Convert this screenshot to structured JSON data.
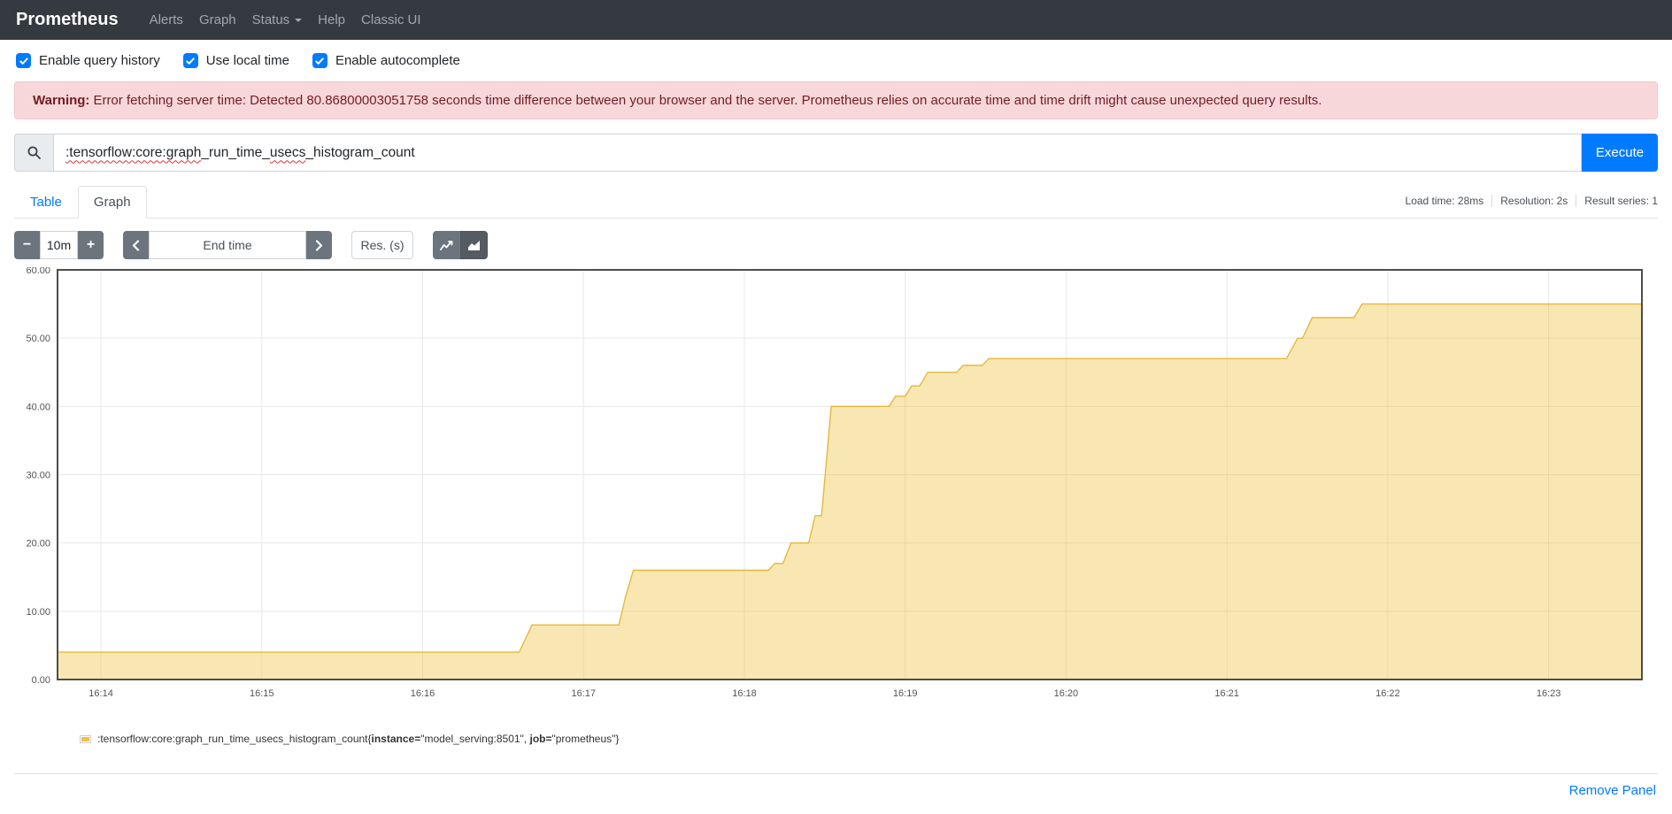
{
  "navbar": {
    "brand": "Prometheus",
    "items": [
      {
        "label": "Alerts",
        "caret": false
      },
      {
        "label": "Graph",
        "caret": false
      },
      {
        "label": "Status",
        "caret": true
      },
      {
        "label": "Help",
        "caret": false
      },
      {
        "label": "Classic UI",
        "caret": false
      }
    ]
  },
  "options": [
    {
      "label": "Enable query history",
      "checked": true
    },
    {
      "label": "Use local time",
      "checked": true
    },
    {
      "label": "Enable autocomplete",
      "checked": true
    }
  ],
  "warning": {
    "prefix": "Warning:",
    "message": "Error fetching server time: Detected 80.86800003051758 seconds time difference between your browser and the server. Prometheus relies on accurate time and time drift might cause unexpected query results."
  },
  "query": {
    "value": ":tensorflow:core:graph_run_time_usecs_histogram_count",
    "parts": [
      {
        "text": ":tensorflow:core:graph",
        "misspelled": true
      },
      {
        "text": "_run_time_",
        "misspelled": false
      },
      {
        "text": "usecs",
        "misspelled": true
      },
      {
        "text": "_histogram_count",
        "misspelled": false
      }
    ],
    "execute_label": "Execute",
    "search_icon": "magnifier"
  },
  "tabs": [
    {
      "label": "Table",
      "active": false
    },
    {
      "label": "Graph",
      "active": true
    }
  ],
  "stats": [
    "Load time: 28ms",
    "Resolution: 2s",
    "Result series: 1"
  ],
  "controls": {
    "minus_label": "−",
    "duration_value": "10m",
    "plus_label": "+",
    "end_time_placeholder": "End time",
    "res_placeholder": "Res. (s)",
    "icons": [
      "chevron-left",
      "chevron-right",
      "line-chart",
      "stacked-chart"
    ],
    "stacked_active": true
  },
  "chart_data": {
    "type": "area",
    "title": "",
    "xlabel": "",
    "ylabel": "",
    "grid": true,
    "legend_position": "bottom-left",
    "ylim": [
      0,
      60
    ],
    "xlim_minutes_after_16_14": [
      -0.27,
      9.58
    ],
    "x_ticks": [
      "16:14",
      "16:15",
      "16:16",
      "16:17",
      "16:18",
      "16:19",
      "16:20",
      "16:21",
      "16:22",
      "16:23"
    ],
    "x_tick_minutes": [
      0,
      1,
      2,
      3,
      4,
      5,
      6,
      7,
      8,
      9
    ],
    "y_ticks": [
      {
        "v": 0,
        "label": "0.00"
      },
      {
        "v": 10,
        "label": "10.00"
      },
      {
        "v": 20,
        "label": "20.00"
      },
      {
        "v": 30,
        "label": "30.00"
      },
      {
        "v": 40,
        "label": "40.00"
      },
      {
        "v": 50,
        "label": "50.00"
      },
      {
        "v": 60,
        "label": "60.00"
      }
    ],
    "series": [
      {
        "name": ":tensorflow:core:graph_run_time_usecs_histogram_count{instance=\"model_serving:8501\", job=\"prometheus\"}",
        "color": "#e7b73b",
        "fill": "rgba(237,194,64,0.4)",
        "points_minutes_value": [
          [
            -0.27,
            4
          ],
          [
            2.6,
            4
          ],
          [
            2.68,
            8
          ],
          [
            3.22,
            8
          ],
          [
            3.26,
            12
          ],
          [
            3.31,
            16
          ],
          [
            4.15,
            16
          ],
          [
            4.19,
            17
          ],
          [
            4.24,
            17
          ],
          [
            4.29,
            20
          ],
          [
            4.4,
            20
          ],
          [
            4.44,
            24
          ],
          [
            4.48,
            24
          ],
          [
            4.54,
            40
          ],
          [
            4.9,
            40
          ],
          [
            4.94,
            41.5
          ],
          [
            5.0,
            41.5
          ],
          [
            5.04,
            43
          ],
          [
            5.09,
            43
          ],
          [
            5.14,
            45
          ],
          [
            5.32,
            45
          ],
          [
            5.36,
            46
          ],
          [
            5.48,
            46
          ],
          [
            5.52,
            47
          ],
          [
            7.37,
            47
          ],
          [
            7.44,
            50
          ],
          [
            7.47,
            50
          ],
          [
            7.53,
            53
          ],
          [
            7.79,
            53
          ],
          [
            7.84,
            55
          ],
          [
            9.58,
            55
          ]
        ]
      }
    ],
    "colors": {
      "border": "#4c4c4c",
      "gridline": "#e8e8e8",
      "tick_text": "#545454"
    }
  },
  "legend": {
    "swatch_color": "#edc240",
    "parts": [
      {
        "text": ":tensorflow:core:graph_run_time_usecs_histogram_count{",
        "bold": false
      },
      {
        "text": "instance=",
        "bold": true
      },
      {
        "text": "\"model_serving:8501\", ",
        "bold": false
      },
      {
        "text": "job=",
        "bold": true
      },
      {
        "text": "\"prometheus\"",
        "bold": false
      },
      {
        "text": "}",
        "bold": false
      }
    ]
  },
  "footer": {
    "remove_panel_label": "Remove Panel"
  }
}
